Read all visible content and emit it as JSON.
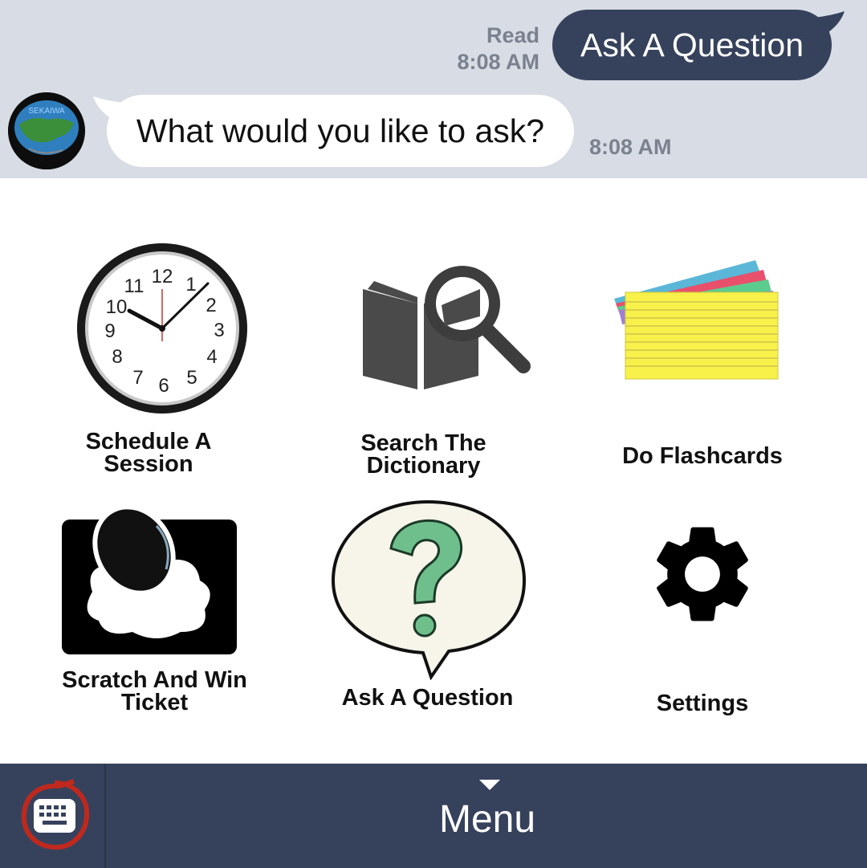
{
  "chat": {
    "outgoing": {
      "text": "Ask A Question",
      "status": "Read",
      "time": "8:08 AM"
    },
    "incoming": {
      "text": "What would you like to ask?",
      "time": "8:08 AM",
      "avatar_text": "SEKAIWA"
    }
  },
  "menu_items": [
    {
      "label_lines": [
        "Schedule A",
        "Session"
      ],
      "icon": "clock-icon"
    },
    {
      "label_lines": [
        "Search The",
        "Dictionary"
      ],
      "icon": "book-search-icon"
    },
    {
      "label_lines": [
        "Do Flashcards"
      ],
      "icon": "flashcards-icon"
    },
    {
      "label_lines": [
        "Scratch And Win",
        "Ticket"
      ],
      "icon": "scratch-ticket-icon"
    },
    {
      "label_lines": [
        "Ask A Question"
      ],
      "icon": "question-bubble-icon"
    },
    {
      "label_lines": [
        "Settings"
      ],
      "icon": "gear-icon"
    }
  ],
  "bottom_bar": {
    "menu_label": "Menu",
    "keyboard_icon": "keyboard-icon",
    "caret_icon": "caret-down-icon"
  },
  "colors": {
    "chat_bg": "#d8dce4",
    "bar_bg": "#36425c",
    "bubble_out": "#36425c",
    "bubble_in": "#ffffff"
  }
}
